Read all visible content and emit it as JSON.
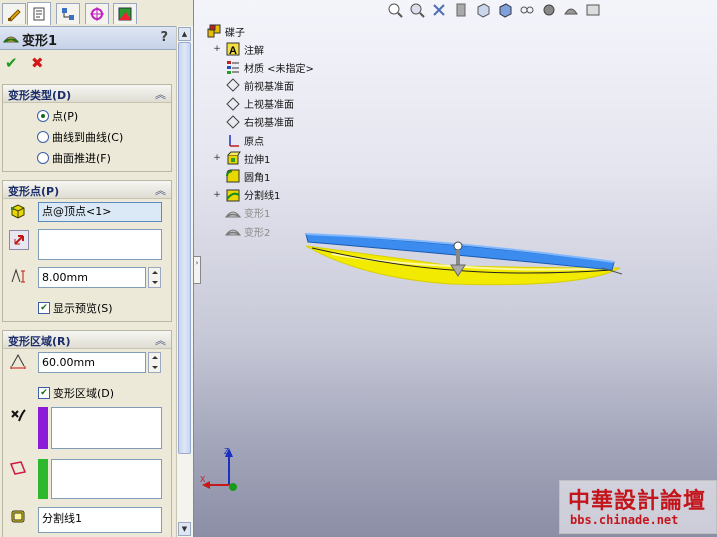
{
  "property_manager": {
    "title": "变形1",
    "help": "?",
    "ok_glyph": "✔",
    "cancel_glyph": "✖",
    "deform_type": {
      "header": "变形类型(D)",
      "options": [
        {
          "label": "点(P)",
          "selected": true
        },
        {
          "label": "曲线到曲线(C)",
          "selected": false
        },
        {
          "label": "曲面推进(F)",
          "selected": false
        }
      ]
    },
    "deform_point": {
      "header": "变形点(P)",
      "point_value": "点@顶点<1>",
      "direction_value": "",
      "distance_value": "8.00mm",
      "show_preview_label": "显示预览(S)",
      "show_preview_checked": true
    },
    "deform_region": {
      "header": "变形区域(R)",
      "radius_value": "60.00mm",
      "region_label": "变形区域(D)",
      "region_checked": true,
      "fixed_list": "",
      "region_list": "",
      "body_value": "分割线1"
    },
    "colors": {
      "purple": "#8b1bd6",
      "green": "#2db82d"
    }
  },
  "tree": {
    "root": "碟子",
    "items": [
      {
        "label": "注解",
        "icon": "annotation-icon",
        "expand": true,
        "dim": false
      },
      {
        "label": "材质 <未指定>",
        "icon": "material-icon",
        "expand": false,
        "dim": false
      },
      {
        "label": "前视基准面",
        "icon": "plane-icon",
        "expand": false,
        "dim": false
      },
      {
        "label": "上视基准面",
        "icon": "plane-icon",
        "expand": false,
        "dim": false
      },
      {
        "label": "右视基准面",
        "icon": "plane-icon",
        "expand": false,
        "dim": false
      },
      {
        "label": "原点",
        "icon": "origin-icon",
        "expand": false,
        "dim": false
      },
      {
        "label": "拉伸1",
        "icon": "extrude-icon",
        "expand": true,
        "dim": false
      },
      {
        "label": "圆角1",
        "icon": "fillet-icon",
        "expand": false,
        "dim": false
      },
      {
        "label": "分割线1",
        "icon": "split-line-icon",
        "expand": true,
        "dim": false
      },
      {
        "label": "变形1",
        "icon": "deform-icon",
        "expand": false,
        "dim": true
      },
      {
        "label": "变形2",
        "icon": "deform-icon",
        "expand": false,
        "dim": true
      }
    ]
  },
  "triad": {
    "x": "X",
    "y": "Y",
    "z": "Z"
  },
  "watermark": {
    "line1": "中華設計論壇",
    "line2": "bbs.chinade.net"
  }
}
